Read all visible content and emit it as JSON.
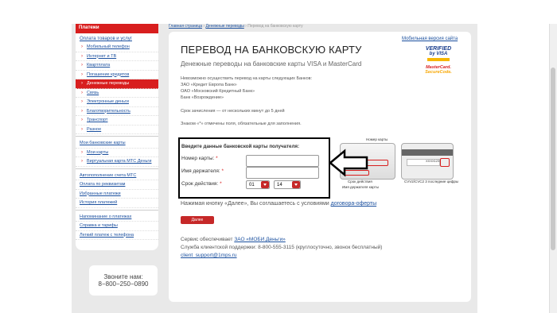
{
  "sidebar": {
    "top_label": "Платежи",
    "section_head": "Оплата товаров и услуг",
    "items": [
      {
        "label": "Мобильный телефон"
      },
      {
        "label": "Интернет и ТВ"
      },
      {
        "label": "Квартплата"
      },
      {
        "label": "Погашение кредитов"
      },
      {
        "label": "Денежные переводы",
        "active": true
      },
      {
        "label": "Связь"
      },
      {
        "label": "Электронные деньги"
      },
      {
        "label": "Благотворительность"
      },
      {
        "label": "Транспорт"
      },
      {
        "label": "Разное"
      }
    ],
    "cards_head": "Мои банковские карты",
    "card_items": [
      {
        "label": "Мои карты"
      },
      {
        "label": "Виртуальная карта МТС Деньги"
      }
    ],
    "links1": [
      "Автопополнение счета МТС",
      "Оплата по реквизитам",
      "Избранные платежи",
      "История платежей"
    ],
    "links2": [
      "Напоминание о платежах",
      "Справка и тарифы",
      "Легкий платеж с телефона"
    ],
    "call_label": "Звоните нам:",
    "call_phone": "8−800−250−0890"
  },
  "breadcrumbs": [
    "Главная страница",
    "Денежные переводы",
    "Перевод на банковскую карту"
  ],
  "header": {
    "mobile_link": "Мобильная версия сайта",
    "title": "ПЕРЕВОД НА БАНКОВСКУЮ КАРТУ",
    "subtitle": "Денежные переводы на банковские карты VISA и MasterCard"
  },
  "logos": {
    "verified_1": "VERIFIED",
    "verified_2": "by VISA",
    "mc_1": "MasterCard.",
    "mc_2": "SecureCode."
  },
  "info": {
    "line1": "Невозможно осуществить перевод на карты следующих Банков:",
    "line2": "ЗАО «Кредит Европа Банк»",
    "line3": "ОАО «Московский Кредитный Банк»",
    "line4": "Банк «Возрождение»",
    "term": "Срок зачисления — от нескольких минут до 5 дней",
    "required_note": "Знаком «*» отмечены поля, обязательные для заполнения."
  },
  "form": {
    "heading": "Введите данные банковской карты получателя:",
    "card_number_label": "Номер карты:",
    "holder_label": "Имя держателя:",
    "expiry_label": "Срок действия:",
    "req": "*",
    "card_number_value": "",
    "holder_value": "",
    "month_value": "01",
    "year_value": "14"
  },
  "card_images": {
    "front_caption_top": "Номер карты",
    "front_caption_expiry": "Срок действия",
    "front_caption_holder": "Имя держателя карты",
    "back_caption": "CVV2/CVC2 3 последние цифры",
    "back_code": "ХХХХ123"
  },
  "hint": {
    "text": "Нажимая кнопку «Далее», Вы соглашаетесь с условиями",
    "link": "договора-оферты"
  },
  "next_button": "Далее",
  "footer": {
    "service_text": "Сервис обеспечивает",
    "service_link": "ЗАО «МОБИ.Деньги»",
    "support_text": "Служба клиентской поддержки: 8-800-555-3115 (круглосуточно, звонок бесплатный)",
    "email": "client_support@1mps.ru"
  }
}
